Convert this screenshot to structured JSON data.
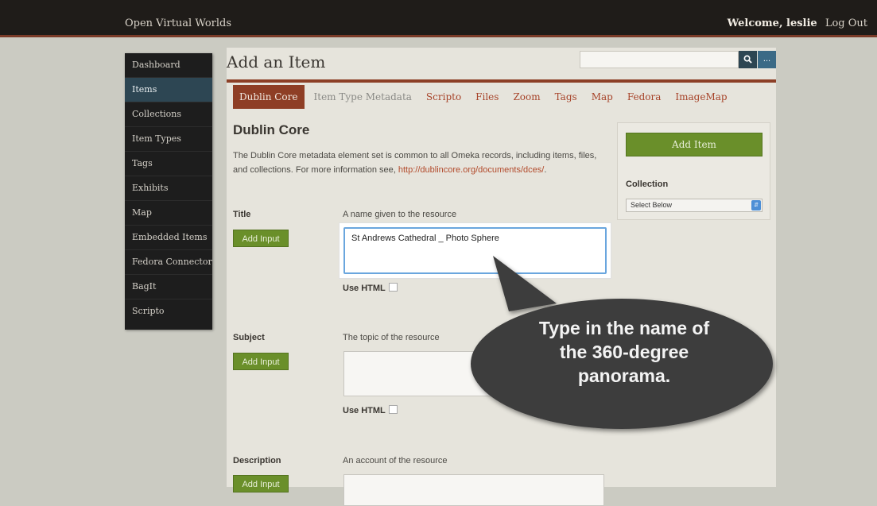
{
  "topbar": {
    "site_title": "Open Virtual Worlds",
    "welcome": "Welcome, leslie",
    "logout": "Log Out"
  },
  "sidebar": {
    "items": [
      {
        "label": "Dashboard"
      },
      {
        "label": "Items"
      },
      {
        "label": "Collections"
      },
      {
        "label": "Item Types"
      },
      {
        "label": "Tags"
      },
      {
        "label": "Exhibits"
      },
      {
        "label": "Map"
      },
      {
        "label": "Embedded Items"
      },
      {
        "label": "Fedora Connector"
      },
      {
        "label": "BagIt"
      },
      {
        "label": "Scripto"
      }
    ]
  },
  "page": {
    "title": "Add an Item",
    "search_placeholder": "",
    "search_icon": "search-icon",
    "more_label": "..."
  },
  "tabs": [
    {
      "label": "Dublin Core"
    },
    {
      "label": "Item Type Metadata"
    },
    {
      "label": "Scripto"
    },
    {
      "label": "Files"
    },
    {
      "label": "Zoom"
    },
    {
      "label": "Tags"
    },
    {
      "label": "Map"
    },
    {
      "label": "Fedora"
    },
    {
      "label": "ImageMap"
    }
  ],
  "section": {
    "title": "Dublin Core",
    "intro": "The Dublin Core metadata element set is common to all Omeka records, including items, files, and collections. For more information see, ",
    "link": "http://dublincore.org/documents/dces/",
    "intro_end": "."
  },
  "fields": {
    "title": {
      "label": "Title",
      "description": "A name given to the resource",
      "value": "St Andrews Cathedral _ Photo Sphere"
    },
    "subject": {
      "label": "Subject",
      "description": "The topic of the resource",
      "value": ""
    },
    "description": {
      "label": "Description",
      "description": "An account of the resource",
      "value": ""
    },
    "add_input_label": "Add Input",
    "use_html_label": "Use HTML"
  },
  "side_panel": {
    "add_item": "Add Item",
    "collection_label": "Collection",
    "collection_value": "Select Below"
  },
  "callout": {
    "line1": "Type in the name of",
    "line2": "the 360-degree",
    "line3": "panorama."
  },
  "colors": {
    "accent": "#8e3e25",
    "button_green": "#6a8f2a",
    "sidebar_active": "#2d4653"
  }
}
